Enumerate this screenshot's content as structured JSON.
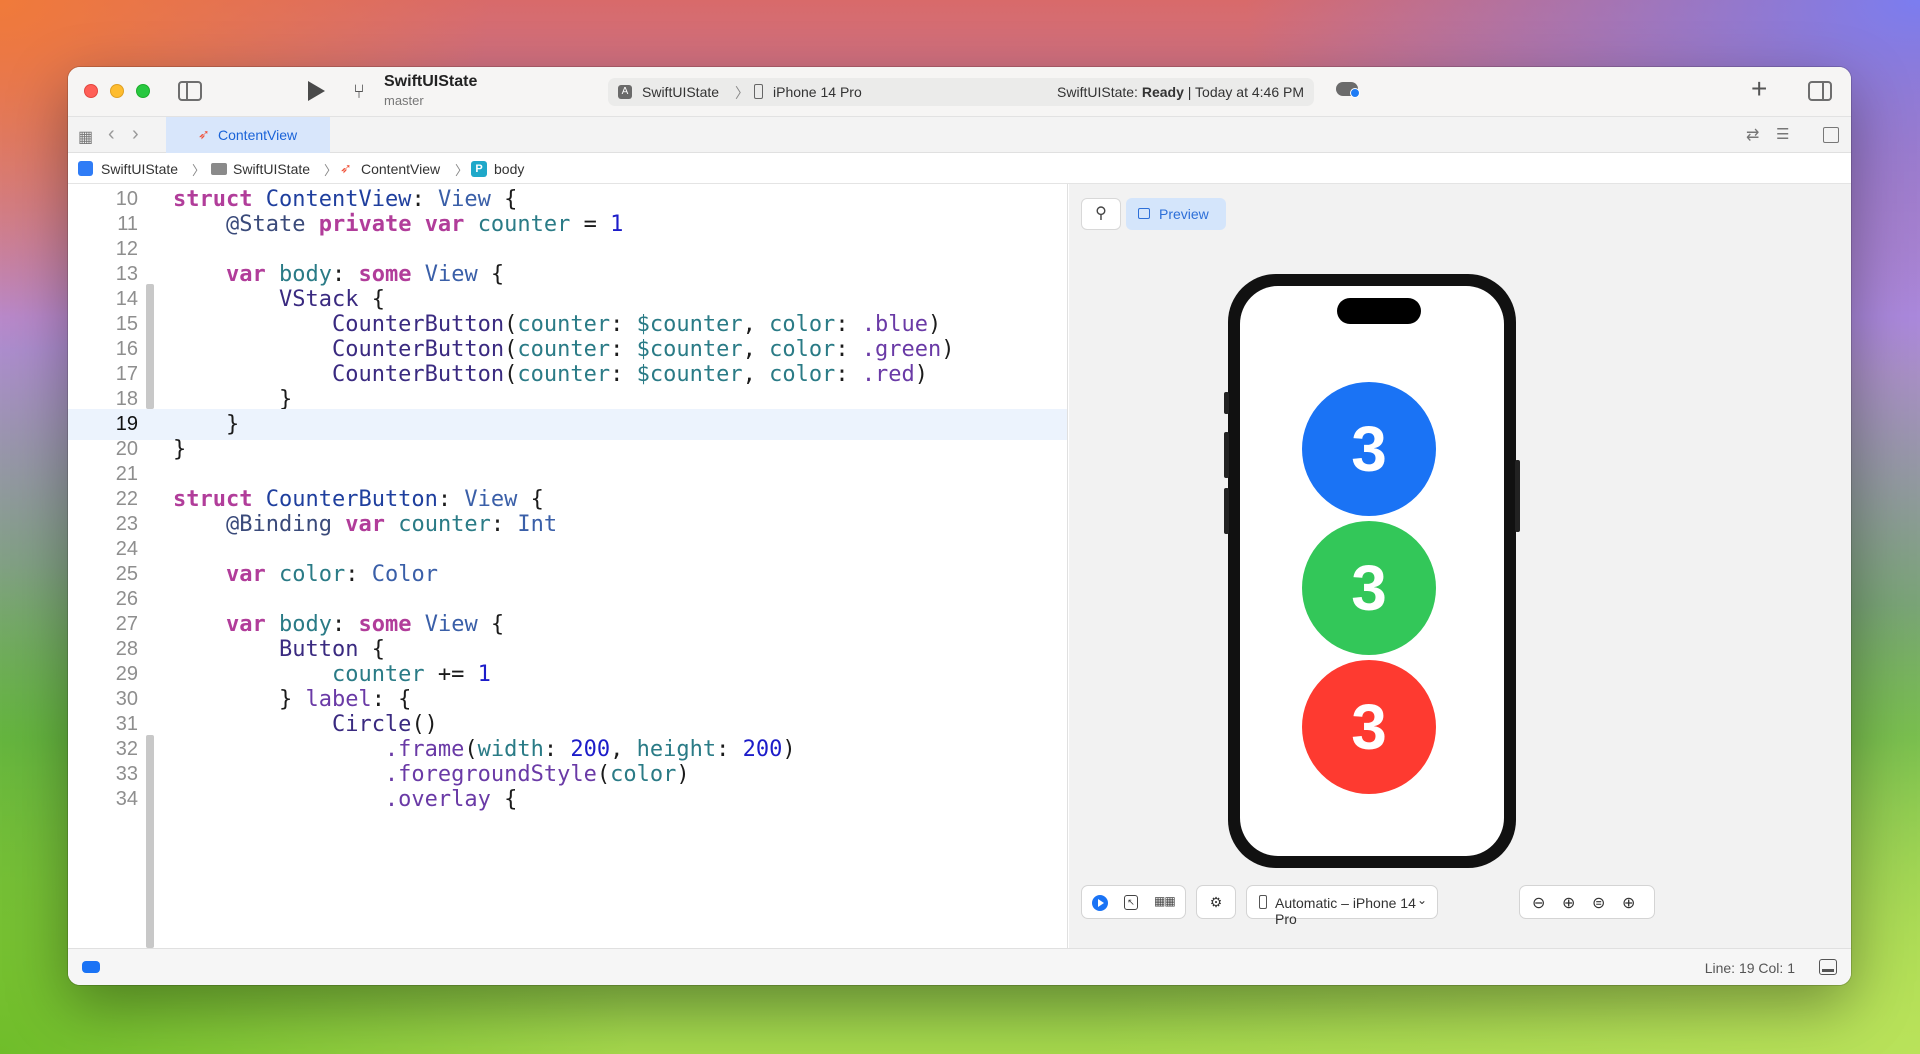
{
  "titlebar": {
    "project_name": "SwiftUIState",
    "branch": "master",
    "scheme": "SwiftUIState",
    "device": "iPhone 14 Pro",
    "status_prefix": "SwiftUIState: ",
    "status_ready": "Ready",
    "status_time": " | Today at 4:46 PM",
    "add_label": "+"
  },
  "tabbar": {
    "active_tab": "ContentView"
  },
  "jumpbar": {
    "items": [
      "SwiftUIState",
      "SwiftUIState",
      "ContentView",
      "body"
    ],
    "body_icon_letter": "P"
  },
  "editor": {
    "current_line": 19,
    "lines": [
      {
        "n": "10"
      },
      {
        "n": "11"
      },
      {
        "n": "12"
      },
      {
        "n": "13"
      },
      {
        "n": "14"
      },
      {
        "n": "15"
      },
      {
        "n": "16"
      },
      {
        "n": "17"
      },
      {
        "n": "18"
      },
      {
        "n": "19"
      },
      {
        "n": "20"
      },
      {
        "n": "21"
      },
      {
        "n": "22"
      },
      {
        "n": "23"
      },
      {
        "n": "24"
      },
      {
        "n": "25"
      },
      {
        "n": "26"
      },
      {
        "n": "27"
      },
      {
        "n": "28"
      },
      {
        "n": "29"
      },
      {
        "n": "30"
      },
      {
        "n": "31"
      },
      {
        "n": "32"
      },
      {
        "n": "33"
      },
      {
        "n": "34"
      }
    ],
    "tokens": {
      "struct": "struct",
      "ContentView": "ContentView",
      "View": "View",
      "State": "@State",
      "private": "private",
      "var": "var",
      "counter": "counter",
      "one": "1",
      "body": "body",
      "some": "some",
      "VStack": "VStack",
      "CounterButton": "CounterButton",
      "dollar_counter": "$counter",
      "color": "color",
      "blue": ".blue",
      "green": ".green",
      "red": ".red",
      "Binding": "@Binding",
      "Int": "Int",
      "Color": "Color",
      "Button": "Button",
      "label": "label",
      "Circle": "Circle",
      "frame": ".frame",
      "width": "width",
      "height": "height",
      "two_hundred": "200",
      "foregroundStyle": ".foregroundStyle",
      "overlay": ".overlay"
    }
  },
  "canvas": {
    "preview_label": "Preview",
    "counter_value": "3",
    "circle_colors": [
      "#1a73f5",
      "#33c759",
      "#fe3a30"
    ],
    "device_selector": "Automatic – iPhone 14 Pro"
  },
  "statusbar": {
    "position": "Line: 19  Col: 1"
  },
  "icons": {
    "close": "close-icon",
    "minimize": "minimize-icon",
    "maximize": "maximize-icon",
    "sidebar": "sidebar-icon",
    "run": "play-icon",
    "branch": "branch-icon",
    "cloud": "cloud-icon",
    "inspector": "inspector-icon",
    "pin": "pin-icon",
    "zoom_out": "zoom-out-icon",
    "zoom_fit": "zoom-fit-icon",
    "zoom_actual": "zoom-actual-icon",
    "zoom_in": "zoom-in-icon"
  },
  "colors": {
    "accent": "#1a73f5",
    "keyword": "#b13d9a",
    "type": "#1f3f9e",
    "number": "#1c1cc9",
    "parameter": "#2a7b86"
  }
}
